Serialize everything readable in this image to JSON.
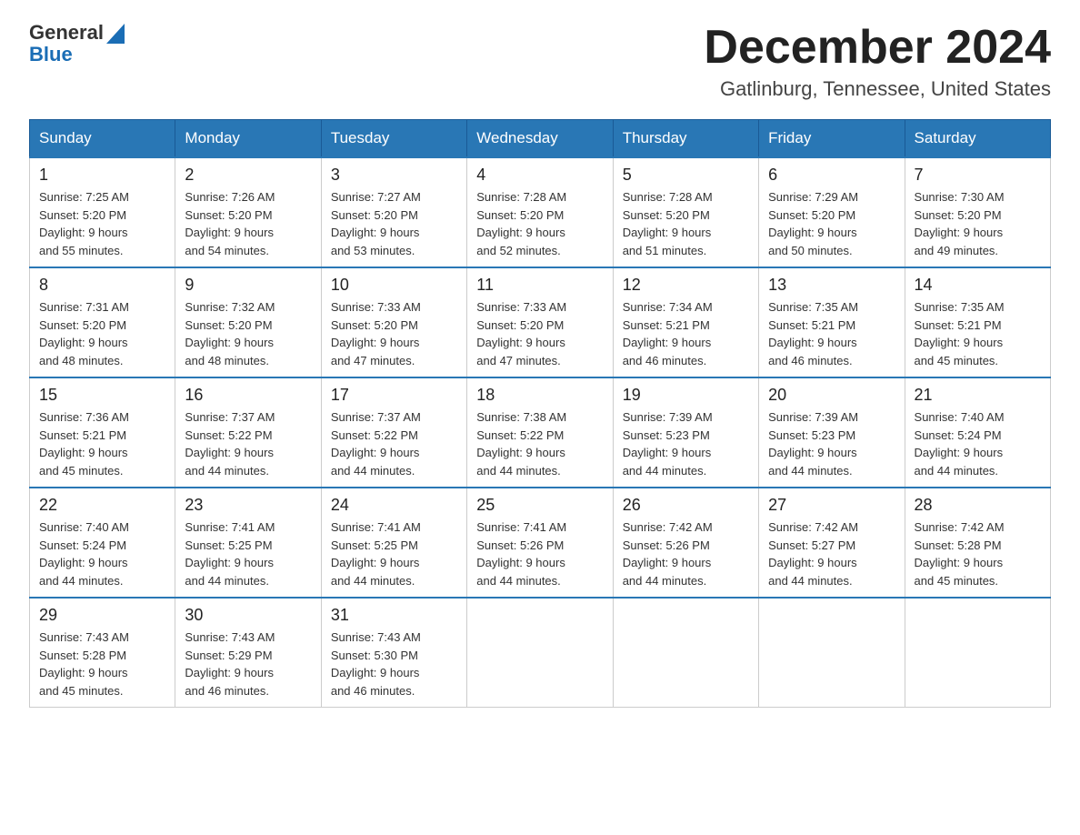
{
  "header": {
    "logo_general": "General",
    "logo_blue": "Blue",
    "month_title": "December 2024",
    "location": "Gatlinburg, Tennessee, United States"
  },
  "days_of_week": [
    "Sunday",
    "Monday",
    "Tuesday",
    "Wednesday",
    "Thursday",
    "Friday",
    "Saturday"
  ],
  "weeks": [
    [
      {
        "day": "1",
        "sunrise": "7:25 AM",
        "sunset": "5:20 PM",
        "daylight": "9 hours and 55 minutes."
      },
      {
        "day": "2",
        "sunrise": "7:26 AM",
        "sunset": "5:20 PM",
        "daylight": "9 hours and 54 minutes."
      },
      {
        "day": "3",
        "sunrise": "7:27 AM",
        "sunset": "5:20 PM",
        "daylight": "9 hours and 53 minutes."
      },
      {
        "day": "4",
        "sunrise": "7:28 AM",
        "sunset": "5:20 PM",
        "daylight": "9 hours and 52 minutes."
      },
      {
        "day": "5",
        "sunrise": "7:28 AM",
        "sunset": "5:20 PM",
        "daylight": "9 hours and 51 minutes."
      },
      {
        "day": "6",
        "sunrise": "7:29 AM",
        "sunset": "5:20 PM",
        "daylight": "9 hours and 50 minutes."
      },
      {
        "day": "7",
        "sunrise": "7:30 AM",
        "sunset": "5:20 PM",
        "daylight": "9 hours and 49 minutes."
      }
    ],
    [
      {
        "day": "8",
        "sunrise": "7:31 AM",
        "sunset": "5:20 PM",
        "daylight": "9 hours and 48 minutes."
      },
      {
        "day": "9",
        "sunrise": "7:32 AM",
        "sunset": "5:20 PM",
        "daylight": "9 hours and 48 minutes."
      },
      {
        "day": "10",
        "sunrise": "7:33 AM",
        "sunset": "5:20 PM",
        "daylight": "9 hours and 47 minutes."
      },
      {
        "day": "11",
        "sunrise": "7:33 AM",
        "sunset": "5:20 PM",
        "daylight": "9 hours and 47 minutes."
      },
      {
        "day": "12",
        "sunrise": "7:34 AM",
        "sunset": "5:21 PM",
        "daylight": "9 hours and 46 minutes."
      },
      {
        "day": "13",
        "sunrise": "7:35 AM",
        "sunset": "5:21 PM",
        "daylight": "9 hours and 46 minutes."
      },
      {
        "day": "14",
        "sunrise": "7:35 AM",
        "sunset": "5:21 PM",
        "daylight": "9 hours and 45 minutes."
      }
    ],
    [
      {
        "day": "15",
        "sunrise": "7:36 AM",
        "sunset": "5:21 PM",
        "daylight": "9 hours and 45 minutes."
      },
      {
        "day": "16",
        "sunrise": "7:37 AM",
        "sunset": "5:22 PM",
        "daylight": "9 hours and 44 minutes."
      },
      {
        "day": "17",
        "sunrise": "7:37 AM",
        "sunset": "5:22 PM",
        "daylight": "9 hours and 44 minutes."
      },
      {
        "day": "18",
        "sunrise": "7:38 AM",
        "sunset": "5:22 PM",
        "daylight": "9 hours and 44 minutes."
      },
      {
        "day": "19",
        "sunrise": "7:39 AM",
        "sunset": "5:23 PM",
        "daylight": "9 hours and 44 minutes."
      },
      {
        "day": "20",
        "sunrise": "7:39 AM",
        "sunset": "5:23 PM",
        "daylight": "9 hours and 44 minutes."
      },
      {
        "day": "21",
        "sunrise": "7:40 AM",
        "sunset": "5:24 PM",
        "daylight": "9 hours and 44 minutes."
      }
    ],
    [
      {
        "day": "22",
        "sunrise": "7:40 AM",
        "sunset": "5:24 PM",
        "daylight": "9 hours and 44 minutes."
      },
      {
        "day": "23",
        "sunrise": "7:41 AM",
        "sunset": "5:25 PM",
        "daylight": "9 hours and 44 minutes."
      },
      {
        "day": "24",
        "sunrise": "7:41 AM",
        "sunset": "5:25 PM",
        "daylight": "9 hours and 44 minutes."
      },
      {
        "day": "25",
        "sunrise": "7:41 AM",
        "sunset": "5:26 PM",
        "daylight": "9 hours and 44 minutes."
      },
      {
        "day": "26",
        "sunrise": "7:42 AM",
        "sunset": "5:26 PM",
        "daylight": "9 hours and 44 minutes."
      },
      {
        "day": "27",
        "sunrise": "7:42 AM",
        "sunset": "5:27 PM",
        "daylight": "9 hours and 44 minutes."
      },
      {
        "day": "28",
        "sunrise": "7:42 AM",
        "sunset": "5:28 PM",
        "daylight": "9 hours and 45 minutes."
      }
    ],
    [
      {
        "day": "29",
        "sunrise": "7:43 AM",
        "sunset": "5:28 PM",
        "daylight": "9 hours and 45 minutes."
      },
      {
        "day": "30",
        "sunrise": "7:43 AM",
        "sunset": "5:29 PM",
        "daylight": "9 hours and 46 minutes."
      },
      {
        "day": "31",
        "sunrise": "7:43 AM",
        "sunset": "5:30 PM",
        "daylight": "9 hours and 46 minutes."
      },
      null,
      null,
      null,
      null
    ]
  ],
  "labels": {
    "sunrise_prefix": "Sunrise: ",
    "sunset_prefix": "Sunset: ",
    "daylight_prefix": "Daylight: "
  }
}
